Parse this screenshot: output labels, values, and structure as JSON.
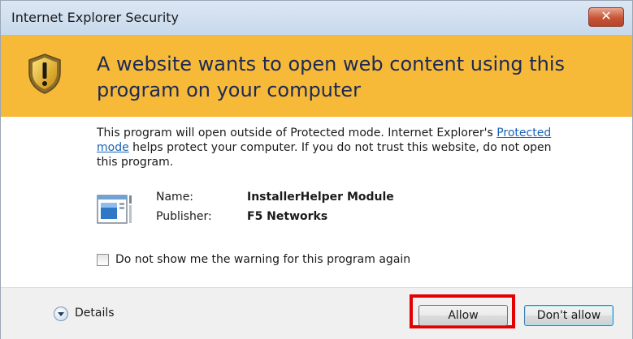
{
  "window": {
    "title": "Internet Explorer Security",
    "close_glyph": "✕"
  },
  "banner": {
    "icon": "shield-warning-icon",
    "heading": "A website wants to open web content using this program on your computer",
    "color": "#f6b938"
  },
  "content": {
    "desc_before": "This program will open outside of Protected mode. Internet Explorer's ",
    "desc_link": "Protected mode",
    "desc_after": " helps protect your computer. If you do not trust this website, do not open this program.",
    "program_icon": "program-window-icon",
    "name_label": "Name:",
    "name_value": "InstallerHelper Module",
    "publisher_label": "Publisher:",
    "publisher_value": "F5 Networks",
    "checkbox_label": "Do not show me the warning for this program again",
    "checkbox_checked": false
  },
  "footer": {
    "details_label": "Details",
    "allow_label": "Allow",
    "dont_allow_label": "Don't allow",
    "highlight_color": "#e30000"
  }
}
